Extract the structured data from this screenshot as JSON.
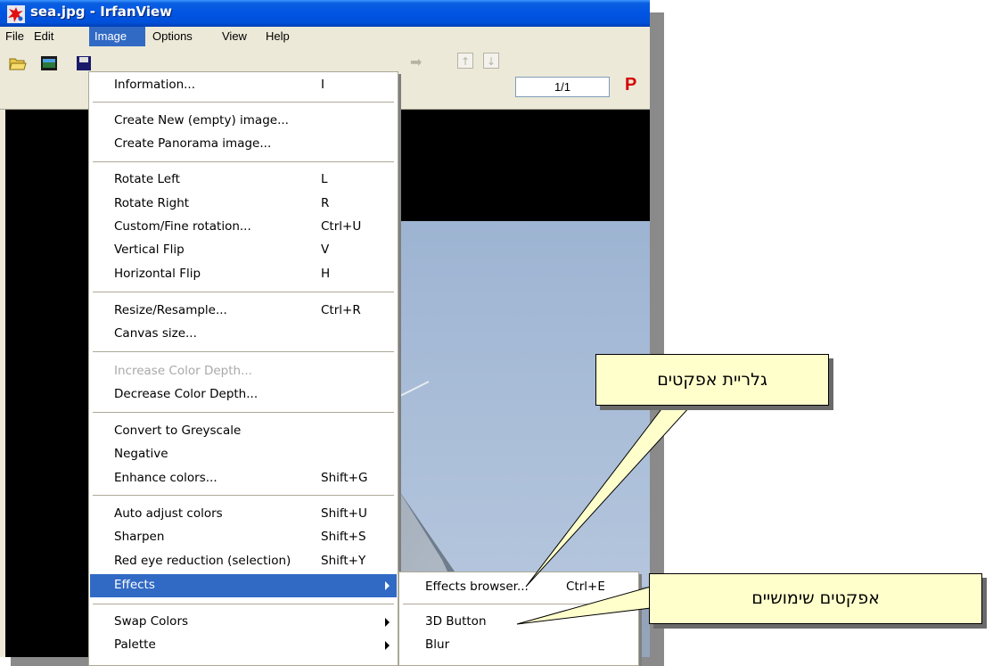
{
  "window": {
    "title": "sea.jpg - IrfanView"
  },
  "menubar": {
    "items": [
      "File",
      "Edit",
      "Image",
      "Options",
      "View",
      "Help"
    ],
    "active": "Image"
  },
  "toolbar": {
    "page_indicator": "1/1",
    "p_label": "P"
  },
  "image_menu": {
    "items": [
      {
        "label": "Information...",
        "shortcut": "I"
      },
      {
        "label": "Create New (empty) image...",
        "shortcut": ""
      },
      {
        "label": "Create Panorama image...",
        "shortcut": ""
      },
      {
        "label": "Rotate Left",
        "shortcut": "L"
      },
      {
        "label": "Rotate Right",
        "shortcut": "R"
      },
      {
        "label": "Custom/Fine rotation...",
        "shortcut": "Ctrl+U"
      },
      {
        "label": "Vertical Flip",
        "shortcut": "V"
      },
      {
        "label": "Horizontal Flip",
        "shortcut": "H"
      },
      {
        "label": "Resize/Resample...",
        "shortcut": "Ctrl+R"
      },
      {
        "label": "Canvas size...",
        "shortcut": ""
      },
      {
        "label": "Increase Color Depth...",
        "shortcut": "",
        "disabled": true
      },
      {
        "label": "Decrease Color Depth...",
        "shortcut": ""
      },
      {
        "label": "Convert to Greyscale",
        "shortcut": ""
      },
      {
        "label": "Negative",
        "shortcut": ""
      },
      {
        "label": "Enhance colors...",
        "shortcut": "Shift+G"
      },
      {
        "label": "Auto adjust colors",
        "shortcut": "Shift+U"
      },
      {
        "label": "Sharpen",
        "shortcut": "Shift+S"
      },
      {
        "label": "Red eye reduction (selection)",
        "shortcut": "Shift+Y"
      },
      {
        "label": "Effects",
        "shortcut": "",
        "submenu": true,
        "active": true
      },
      {
        "label": "Swap Colors",
        "shortcut": "",
        "submenu": true
      },
      {
        "label": "Palette",
        "shortcut": "",
        "submenu": true
      }
    ]
  },
  "effects_submenu": {
    "items": [
      {
        "label": "Effects browser...",
        "shortcut": "Ctrl+E"
      },
      {
        "label": "3D Button",
        "shortcut": ""
      },
      {
        "label": "Blur",
        "shortcut": ""
      }
    ]
  },
  "callouts": {
    "effects_gallery": "גלריית אפקטים",
    "useful_effects": "אפקטים שימושיים"
  },
  "colors": {
    "title_bar": "#0054e3",
    "menu_highlight": "#316ac5",
    "callout_fill": "#ffffcc"
  }
}
